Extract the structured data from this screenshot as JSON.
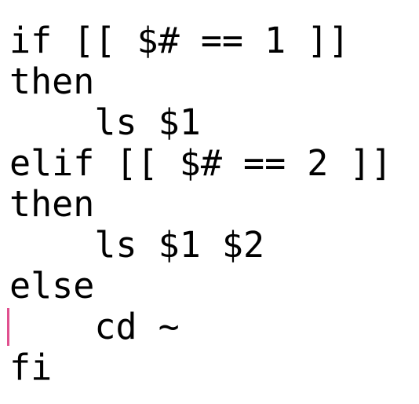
{
  "editor": {
    "lines": [
      "if [[ $# == 1 ]]",
      "then",
      "    ls $1",
      "elif [[ $# == 2 ]]",
      "then",
      "    ls $1 $2",
      "else",
      "    cd ~",
      "fi"
    ],
    "cursor_line": 8,
    "cursor_color": "#e0508f",
    "text_color": "#000000",
    "background_color": "#ffffff"
  }
}
